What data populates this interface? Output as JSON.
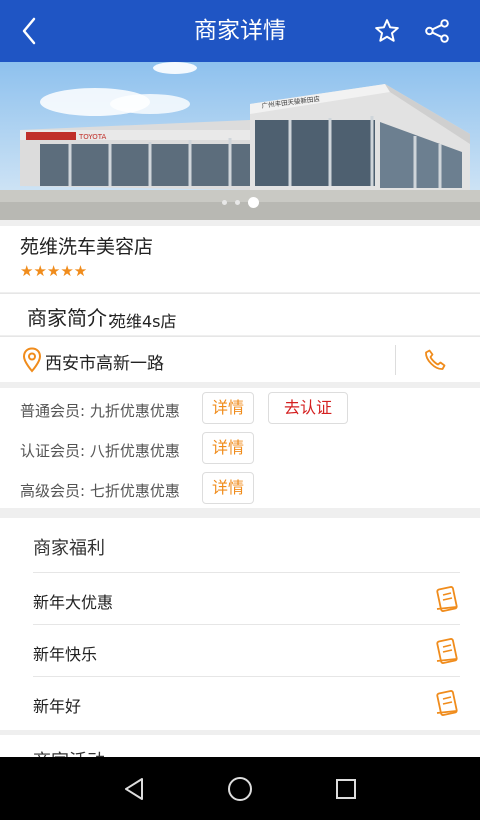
{
  "header": {
    "title": "商家详情",
    "back_icon": "back-arrow-icon",
    "favorite_icon": "star-outline-icon",
    "share_icon": "share-icon",
    "color": "#1f55c4"
  },
  "banner": {
    "slide_count": 3,
    "active_index": 2,
    "building_sign": "广州丰田天骏新田店",
    "brand_sign": "TOYOTA"
  },
  "shop": {
    "name": "苑维洗车美容店",
    "rating": 5,
    "stars": "★★★★★",
    "intro_label": "商家简介:",
    "intro_value": "苑维4s店",
    "address": "西安市高新一路"
  },
  "memberships": [
    {
      "text": "普通会员: 九折优惠优惠",
      "detail_label": "详情",
      "verify_label": "去认证"
    },
    {
      "text": "认证会员: 八折优惠优惠",
      "detail_label": "详情"
    },
    {
      "text": "高级会员: 七折优惠优惠",
      "detail_label": "详情"
    }
  ],
  "welfare": {
    "title": "商家福利",
    "items": [
      {
        "label": "新年大优惠"
      },
      {
        "label": "新年快乐"
      },
      {
        "label": "新年好"
      }
    ]
  },
  "next_section_partial": "商家活动",
  "system_nav": {
    "back_icon": "nav-back-triangle-icon",
    "home_icon": "nav-home-circle-icon",
    "recents_icon": "nav-recents-square-icon"
  },
  "colors": {
    "accent_orange": "#f08c1c",
    "verify_red": "#d42020"
  }
}
